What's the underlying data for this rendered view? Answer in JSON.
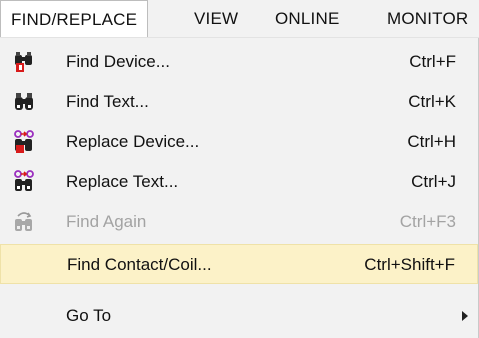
{
  "menubar": {
    "items": [
      {
        "label": "FIND/REPLACE",
        "active": true
      },
      {
        "label": "VIEW"
      },
      {
        "label": "ONLINE"
      },
      {
        "label": "MONITOR"
      }
    ]
  },
  "menu": {
    "items": [
      {
        "label": "Find Device...",
        "shortcut": "Ctrl+F",
        "icon": "find-device-icon"
      },
      {
        "label": "Find Text...",
        "shortcut": "Ctrl+K",
        "icon": "binoculars-icon"
      },
      {
        "label": "Replace Device...",
        "shortcut": "Ctrl+H",
        "icon": "replace-device-icon"
      },
      {
        "label": "Replace Text...",
        "shortcut": "Ctrl+J",
        "icon": "replace-text-icon"
      },
      {
        "label": "Find Again",
        "shortcut": "Ctrl+F3",
        "icon": "find-again-icon",
        "disabled": true
      },
      {
        "label": "Find Contact/Coil...",
        "shortcut": "Ctrl+Shift+F",
        "highlighted": true
      },
      {
        "label": "Go To",
        "submenu": true
      }
    ]
  },
  "colors": {
    "highlight": "#fcf2c8",
    "menu_background": "#f2f2f2",
    "disabled_text": "#a3a3a3",
    "accent_red": "#d81b1b",
    "accent_purple": "#9b2fbf"
  }
}
